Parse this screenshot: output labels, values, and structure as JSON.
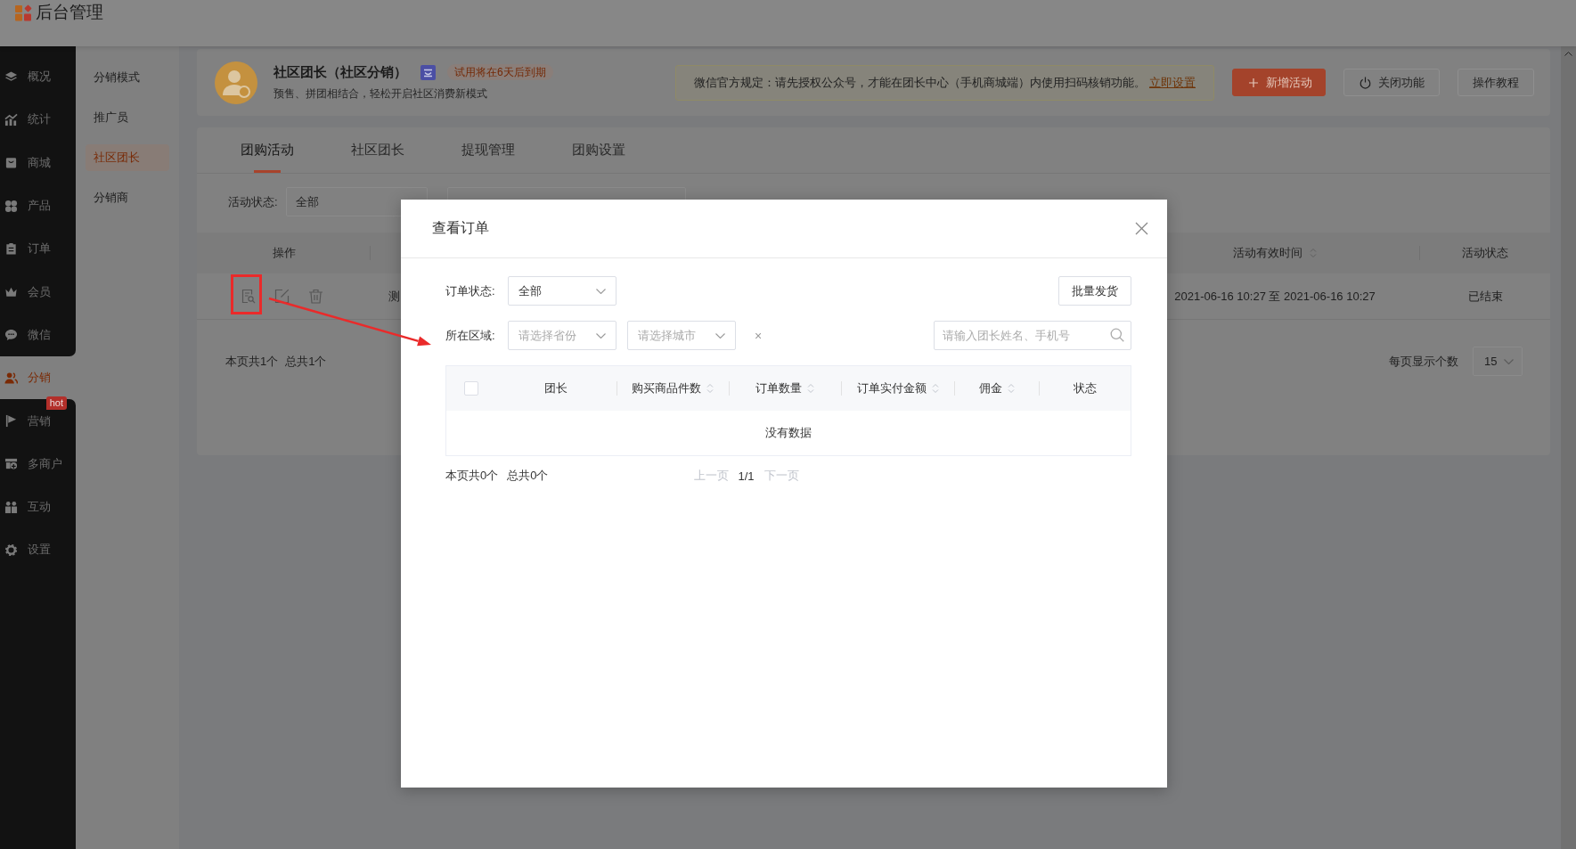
{
  "app": {
    "title": "后台管理"
  },
  "nav": {
    "items": [
      {
        "label": "概况",
        "selected": false
      },
      {
        "label": "统计",
        "selected": false
      },
      {
        "label": "商城",
        "selected": false
      },
      {
        "label": "产品",
        "selected": false
      },
      {
        "label": "订单",
        "selected": false
      },
      {
        "label": "会员",
        "selected": false
      },
      {
        "label": "微信",
        "selected": false
      },
      {
        "label": "分销",
        "selected": true
      },
      {
        "label": "营销",
        "selected": false,
        "badge": "hot"
      },
      {
        "label": "多商户",
        "selected": false
      },
      {
        "label": "互动",
        "selected": false
      },
      {
        "label": "设置",
        "selected": false
      }
    ]
  },
  "subnav": {
    "items": [
      {
        "label": "分销模式",
        "selected": false
      },
      {
        "label": "推广员",
        "selected": false
      },
      {
        "label": "社区团长",
        "selected": true
      },
      {
        "label": "分销商",
        "selected": false
      }
    ]
  },
  "header_card": {
    "title": "社区团长（社区分销）",
    "trial_notice": "试用将在6天后到期",
    "subtitle": "预售、拼团相结合，轻松开启社区消费新模式",
    "notice": {
      "text": "微信官方规定：请先授权公众号，才能在团长中心（手机商城端）内使用扫码核销功能。",
      "link": "立即设置"
    },
    "buttons": [
      {
        "label": "新增活动",
        "kind": "primary"
      },
      {
        "label": "关闭功能",
        "kind": "power"
      },
      {
        "label": "操作教程",
        "kind": "plain"
      }
    ]
  },
  "tabs": [
    {
      "label": "团购活动",
      "selected": true
    },
    {
      "label": "社区团长",
      "selected": false
    },
    {
      "label": "提现管理",
      "selected": false
    },
    {
      "label": "团购设置",
      "selected": false
    }
  ],
  "filter": {
    "label": "活动状态:",
    "status": "全部"
  },
  "table": {
    "columns": [
      {
        "label": "操作",
        "sortable": false
      },
      {
        "label": "活动有效时间",
        "sortable": true
      },
      {
        "label": "活动状态",
        "sortable": false
      }
    ],
    "rows": [
      {
        "column_2": "测",
        "valid_time": "2021-06-16 10:27 至 2021-06-16 10:27",
        "status": "已结束"
      }
    ]
  },
  "pagination": {
    "summary": "本页共1个",
    "total": "总共1个",
    "page_size_label": "每页显示个数",
    "page_size": "15"
  },
  "modal": {
    "title": "查看订单",
    "order_status": {
      "label": "订单状态:",
      "value": "全部"
    },
    "batch_button": "批量发货",
    "region": {
      "label": "所在区域:",
      "province_select": {
        "placeholder": "请选择省份"
      },
      "city_select": {
        "placeholder": "请选择城市"
      },
      "clear": "×"
    },
    "search": {
      "placeholder": "请输入团长姓名、手机号"
    },
    "table": {
      "select_all": {
        "checked": false
      },
      "columns": [
        {
          "label": "团长",
          "sortable": false
        },
        {
          "label": "购买商品件数",
          "sortable": true
        },
        {
          "label": "订单数量",
          "sortable": true
        },
        {
          "label": "订单实付金额",
          "sortable": true
        },
        {
          "label": "佣金",
          "sortable": true
        },
        {
          "label": "状态",
          "sortable": false
        }
      ],
      "empty_text": "没有数据"
    },
    "pagination": {
      "summary": "本页共0个",
      "total": "总共0个",
      "prev": {
        "label": "上一页",
        "disabled": true
      },
      "page": "1/1",
      "next": {
        "label": "下一页",
        "disabled": true
      }
    }
  }
}
